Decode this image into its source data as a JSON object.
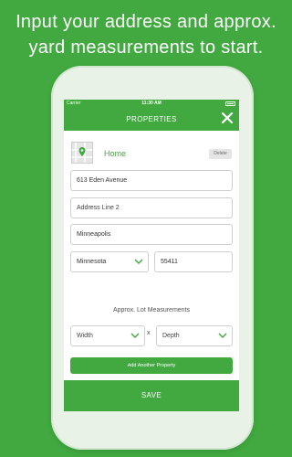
{
  "headline": {
    "line1": "Input your address and approx.",
    "line2": "yard measurements to start."
  },
  "status_bar": {
    "carrier": "Carrier",
    "time": "11:30 AM"
  },
  "nav": {
    "title": "PROPERTIES",
    "close_icon": "close-icon"
  },
  "property": {
    "name": "Home",
    "delete_label": "Delete",
    "address_line1": "613 Eden Avenue",
    "address_line2_placeholder": "Address Line 2",
    "city": "Minneapolis",
    "state": "Minnesota",
    "zip": "55411"
  },
  "lot": {
    "label": "Approx. Lot Measurements",
    "width_placeholder": "Width",
    "separator": "x",
    "depth_placeholder": "Depth"
  },
  "add_property_label": "Add Another Property",
  "save_label": "SAVE",
  "colors": {
    "brand_green": "#41a940",
    "chevron_green": "#41a940"
  }
}
